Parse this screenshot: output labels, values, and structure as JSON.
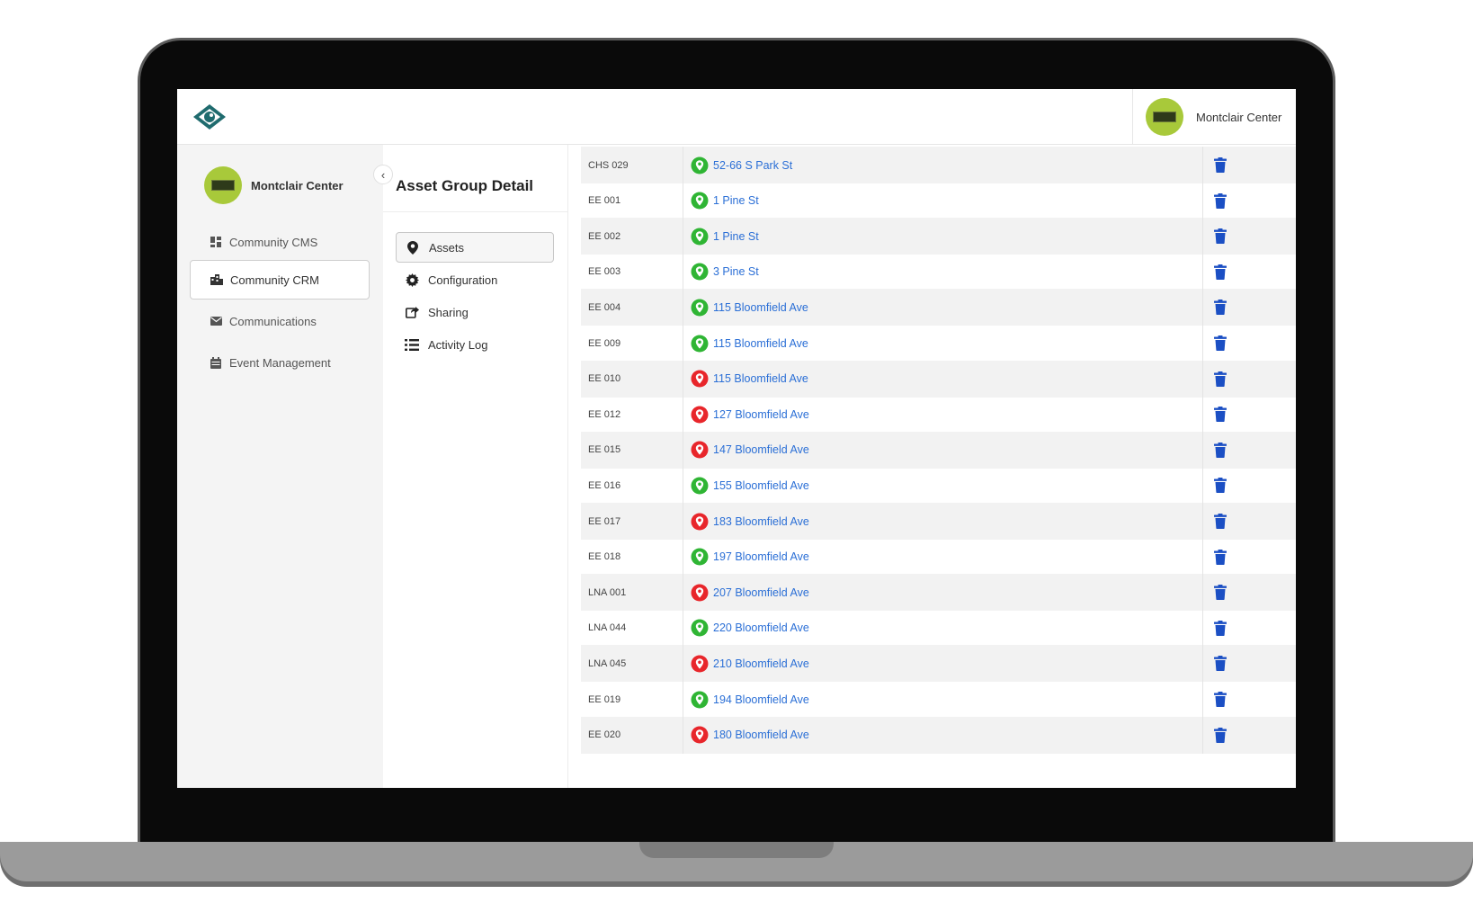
{
  "header": {
    "logo_icon": "eye-icon",
    "account_name": "Montclair Center"
  },
  "sidebar": {
    "account_name": "Montclair Center",
    "items": [
      {
        "label": "Community CMS",
        "icon": "dashboard-icon",
        "active": false
      },
      {
        "label": "Community CRM",
        "icon": "building-icon",
        "active": true
      },
      {
        "label": "Communications",
        "icon": "envelope-icon",
        "active": false
      },
      {
        "label": "Event Management",
        "icon": "calendar-icon",
        "active": false
      }
    ]
  },
  "detail": {
    "title": "Asset Group Detail",
    "items": [
      {
        "label": "Assets",
        "icon": "map-pin-icon",
        "active": true
      },
      {
        "label": "Configuration",
        "icon": "gear-icon",
        "active": false
      },
      {
        "label": "Sharing",
        "icon": "share-icon",
        "active": false
      },
      {
        "label": "Activity Log",
        "icon": "list-icon",
        "active": false
      }
    ]
  },
  "colors": {
    "status_green": "#2fb534",
    "status_red": "#e8262b",
    "link_blue": "#2b6fd6",
    "delete_blue": "#1b4fc4"
  },
  "assets": [
    {
      "code": "CHS 029",
      "address": "52-66 S Park St",
      "status": "green"
    },
    {
      "code": "EE 001",
      "address": "1 Pine St",
      "status": "green"
    },
    {
      "code": "EE 002",
      "address": "1 Pine St",
      "status": "green"
    },
    {
      "code": "EE 003",
      "address": "3 Pine St",
      "status": "green"
    },
    {
      "code": "EE 004",
      "address": "115 Bloomfield Ave",
      "status": "green"
    },
    {
      "code": "EE 009",
      "address": "115 Bloomfield Ave",
      "status": "green"
    },
    {
      "code": "EE 010",
      "address": "115 Bloomfield Ave",
      "status": "red"
    },
    {
      "code": "EE 012",
      "address": "127 Bloomfield Ave",
      "status": "red"
    },
    {
      "code": "EE 015",
      "address": "147 Bloomfield Ave",
      "status": "red"
    },
    {
      "code": "EE 016",
      "address": "155 Bloomfield Ave",
      "status": "green"
    },
    {
      "code": "EE 017",
      "address": "183 Bloomfield Ave",
      "status": "red"
    },
    {
      "code": "EE 018",
      "address": "197 Bloomfield Ave",
      "status": "green"
    },
    {
      "code": "LNA 001",
      "address": "207 Bloomfield Ave",
      "status": "red"
    },
    {
      "code": "LNA 044",
      "address": "220 Bloomfield Ave",
      "status": "green"
    },
    {
      "code": "LNA 045",
      "address": "210 Bloomfield Ave",
      "status": "red"
    },
    {
      "code": "EE 019",
      "address": "194 Bloomfield Ave",
      "status": "green"
    },
    {
      "code": "EE 020",
      "address": "180 Bloomfield Ave",
      "status": "red"
    }
  ]
}
